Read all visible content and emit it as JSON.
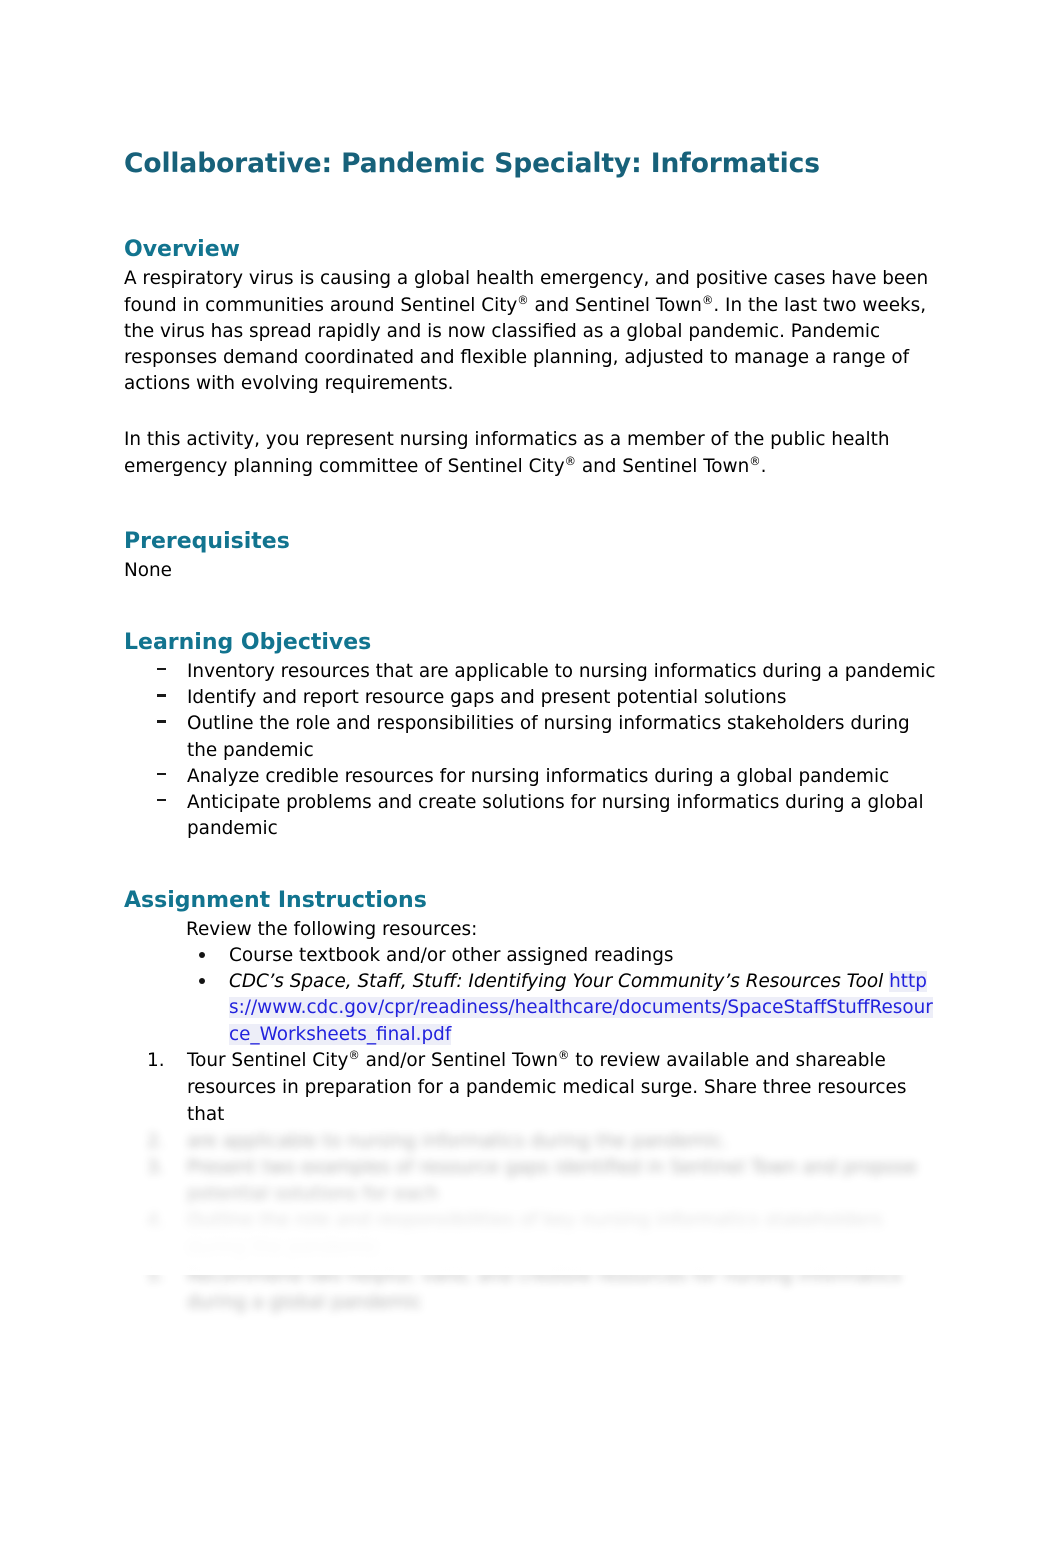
{
  "document": {
    "title": "Collaborative: Pandemic Specialty:  Informatics",
    "sections": {
      "overview": {
        "heading": "Overview",
        "paragraph_1_part_1": "A respiratory virus is causing a global health emergency, and positive cases have been found in communities around Sentinel City",
        "reg_mark": "®",
        "paragraph_1_part_2": " and Sentinel Town",
        "paragraph_1_part_3": ".  In the last two weeks, the virus has spread rapidly and is now classified as a global pandemic.  Pandemic responses demand coordinated and flexible planning, adjusted to manage a range of actions with evolving requirements.",
        "paragraph_2_part_1": "In this activity, you represent nursing informatics as a member of the public health emergency planning committee of Sentinel City",
        "paragraph_2_part_2": " and Sentinel Town",
        "paragraph_2_part_3": "."
      },
      "prerequisites": {
        "heading": "Prerequisites",
        "value": "None"
      },
      "learning_objectives": {
        "heading": "Learning Objectives",
        "items": [
          "Inventory resources that are applicable to nursing informatics during a pandemic",
          "Identify and report resource gaps and present potential solutions",
          "Outline the role and responsibilities of nursing informatics stakeholders during the pandemic",
          "Analyze credible resources for nursing informatics during a global pandemic",
          "Anticipate problems and create solutions for nursing informatics during a global pandemic"
        ]
      },
      "assignment_instructions": {
        "heading": "Assignment Instructions",
        "intro": "Review the following resources:",
        "resources": [
          {
            "text": "Course textbook and/or other assigned readings",
            "italic": false,
            "link": null
          },
          {
            "text": "CDC’s Space, Staff, Stuff: Identifying Your Community’s Resources Tool",
            "italic": true,
            "link": "https://www.cdc.gov/cpr/readiness/healthcare/documents/SpaceStaffStuffResource_Worksheets_final.pdf"
          }
        ],
        "numbered_items": [
          {
            "part_1": "Tour Sentinel City",
            "part_2": " and/or Sentinel Town",
            "part_3": " to review available and shareable resources in preparation for a pandemic medical surge.  Share three resources that",
            "obscured_tail": "are applicable to nursing informatics during the pandemic."
          }
        ],
        "obscured_items": [
          "Present two examples of resource gaps identified in Sentinel Town and propose potential solutions for each",
          "Outline the role and responsibilities of key nursing informatics stakeholders during the pandemic",
          "Recommend two helpful, valid, and credible resources for nursing informatics during a global pandemic"
        ]
      }
    }
  },
  "colors": {
    "title": "#17617a",
    "heading": "#12748f",
    "body_text": "#000000",
    "link": "#2222dd",
    "link_highlight": "#edeef8",
    "page_background": "#ffffff"
  }
}
